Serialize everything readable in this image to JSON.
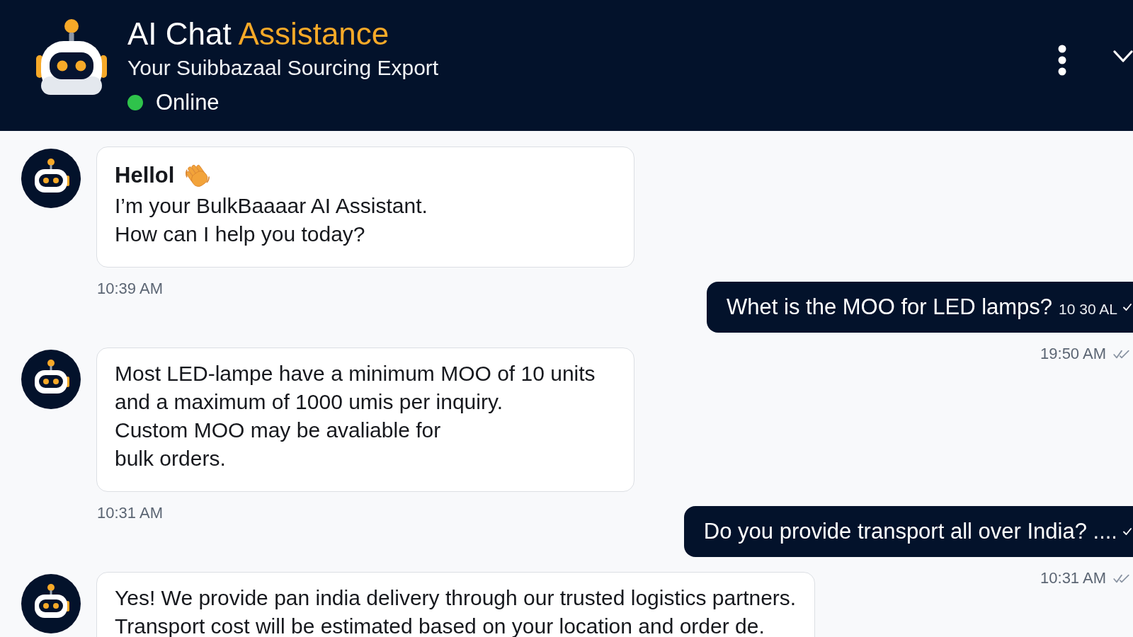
{
  "header": {
    "title": "AI Chat",
    "title_accent": "Assistance",
    "subtitle": "Your Suibbazaal Sourcing Export",
    "status": {
      "label": "Online",
      "online": true
    }
  },
  "messages": [
    {
      "kind": "bot",
      "heading": "Hellol",
      "lines": [
        "I’m your BulkBaaaar AI Assistant.",
        "How can I help you today?"
      ],
      "time": "10:39 AM"
    },
    {
      "kind": "user",
      "text": "Whet is the MOO for LED lamps?",
      "inline_time": "10 30 AL",
      "time": "19:50 AM",
      "read": true
    },
    {
      "kind": "bot",
      "lines": [
        "Most LED-lampe have a minimum MOO of 10 units",
        "and a maximum of 1000 umis per inquiry.",
        "Custom MOO may be avaliable for",
        "bulk orders."
      ],
      "time": "10:31 AM"
    },
    {
      "kind": "user",
      "text": "Do you provide transport all over India? ....",
      "time": "10:31 AM",
      "read": true
    },
    {
      "kind": "bot",
      "lines": [
        "Yes! We provide pan india delivery through our trusted logistics partners.",
        "Transport cost will be estimated based on your location and order de."
      ]
    }
  ]
}
